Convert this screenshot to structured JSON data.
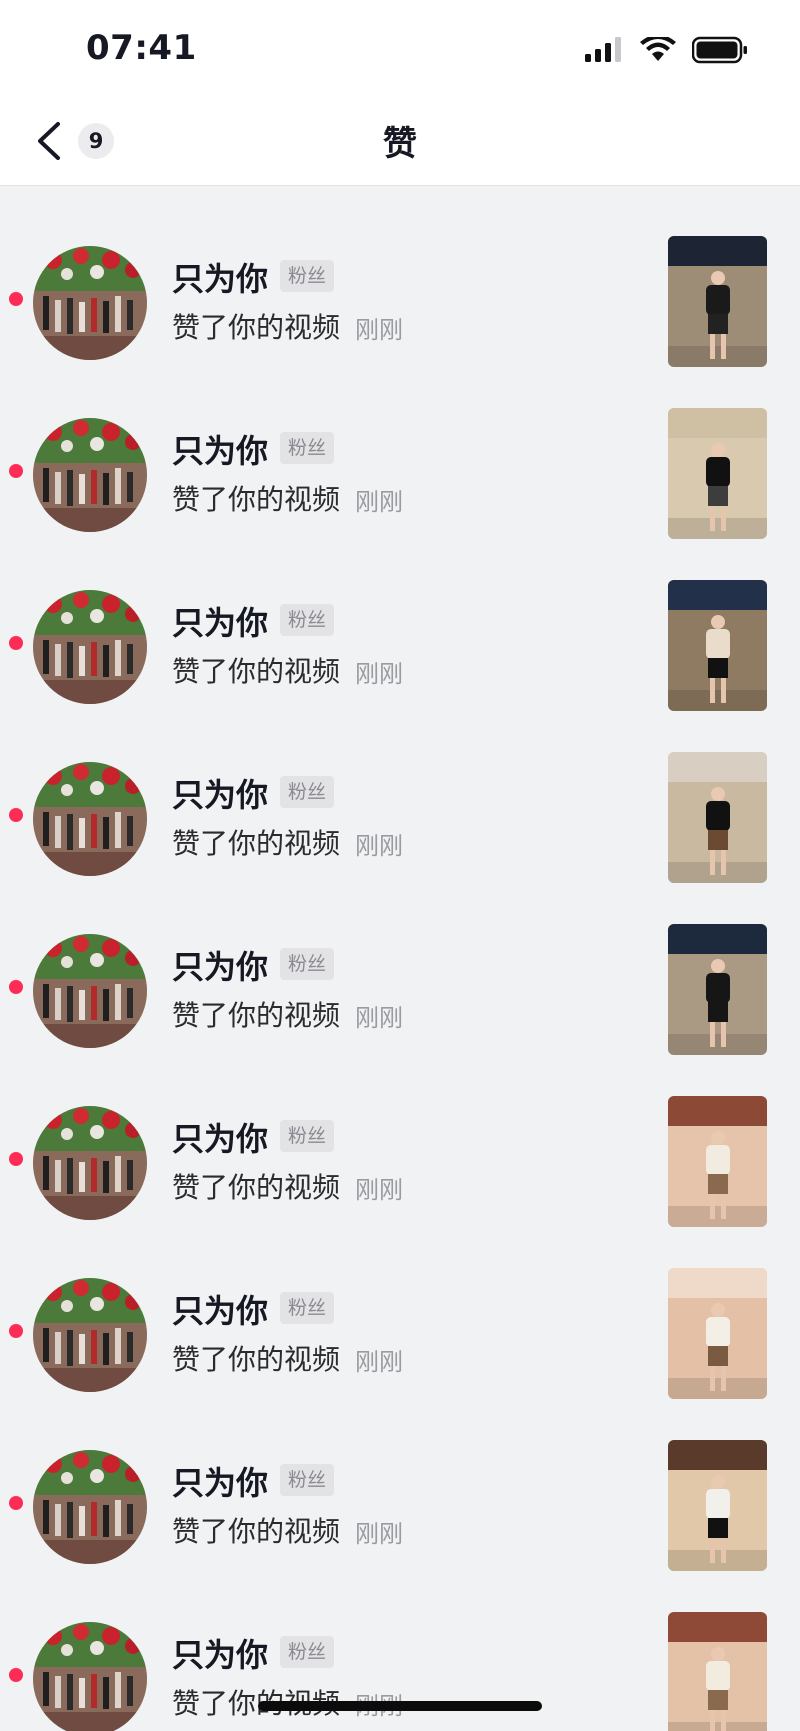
{
  "status_bar": {
    "time": "07:41",
    "icons": [
      "signal-icon",
      "wifi-icon",
      "battery-icon"
    ]
  },
  "header": {
    "back_icon": "chevron-left-icon",
    "unread_count": "9",
    "title": "赞"
  },
  "colors": {
    "accent_dot": "#fe2c55",
    "background": "#f1f2f3",
    "header_bg": "#ffffff"
  },
  "notifications": [
    {
      "name": "只为你",
      "tag": "粉丝",
      "action": "赞了你的视频",
      "time": "刚刚",
      "thumb": {
        "bg": "#9d8d76",
        "top": "#1d2433",
        "outfit": "#1a1a1a",
        "skirt": "#222222"
      }
    },
    {
      "name": "只为你",
      "tag": "粉丝",
      "action": "赞了你的视频",
      "time": "刚刚",
      "thumb": {
        "bg": "#d9c9ae",
        "top": "#cfc0a4",
        "outfit": "#111111",
        "skirt": "#3d3d3d"
      }
    },
    {
      "name": "只为你",
      "tag": "粉丝",
      "action": "赞了你的视频",
      "time": "刚刚",
      "thumb": {
        "bg": "#8f7a62",
        "top": "#22304a",
        "outfit": "#e9dccb",
        "skirt": "#111111"
      }
    },
    {
      "name": "只为你",
      "tag": "粉丝",
      "action": "赞了你的视频",
      "time": "刚刚",
      "thumb": {
        "bg": "#c9b9a0",
        "top": "#d8cfc2",
        "outfit": "#111111",
        "skirt": "#6b4a33"
      }
    },
    {
      "name": "只为你",
      "tag": "粉丝",
      "action": "赞了你的视频",
      "time": "刚刚",
      "thumb": {
        "bg": "#aa9a84",
        "top": "#1d2a3e",
        "outfit": "#161616",
        "skirt": "#161616"
      }
    },
    {
      "name": "只为你",
      "tag": "粉丝",
      "action": "赞了你的视频",
      "time": "刚刚",
      "thumb": {
        "bg": "#e6c4ab",
        "top": "#8c4a36",
        "outfit": "#f2ebe0",
        "skirt": "#8a6a4e"
      }
    },
    {
      "name": "只为你",
      "tag": "粉丝",
      "action": "赞了你的视频",
      "time": "刚刚",
      "thumb": {
        "bg": "#e3c0a6",
        "top": "#efd9c8",
        "outfit": "#f4efe6",
        "skirt": "#7a5a40"
      }
    },
    {
      "name": "只为你",
      "tag": "粉丝",
      "action": "赞了你的视频",
      "time": "刚刚",
      "thumb": {
        "bg": "#e1c8a8",
        "top": "#5a3a2a",
        "outfit": "#f2f0ea",
        "skirt": "#111111"
      }
    },
    {
      "name": "只为你",
      "tag": "粉丝",
      "action": "赞了你的视频",
      "time": "刚刚",
      "thumb": {
        "bg": "#e4c2a8",
        "top": "#8e4a36",
        "outfit": "#f2ebe0",
        "skirt": "#8a6a4e"
      }
    }
  ]
}
